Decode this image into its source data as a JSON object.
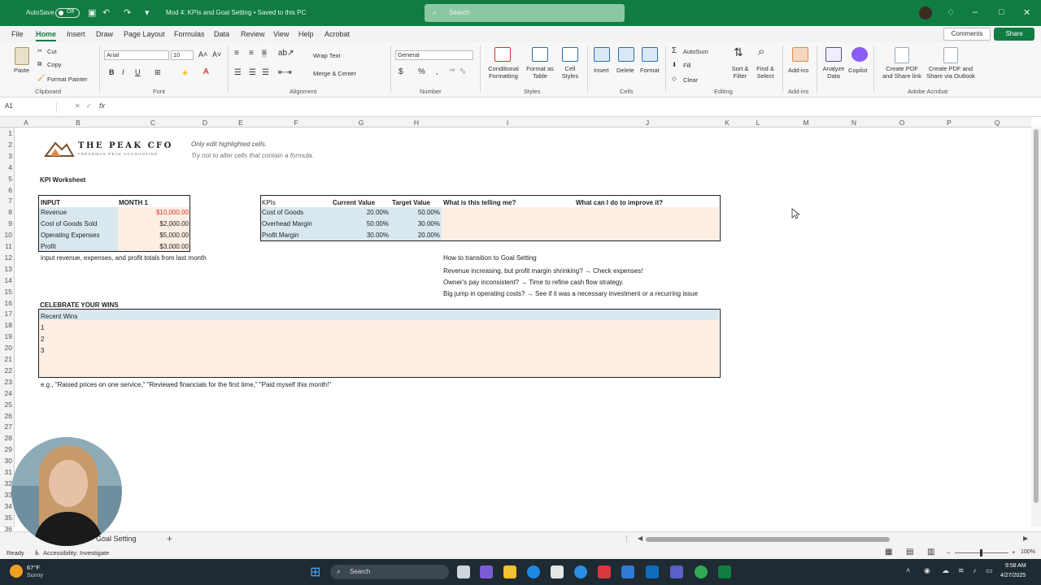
{
  "titlebar": {
    "autosave_label": "AutoSave",
    "autosave_state": "Off",
    "doc_title": "Mod 4: KPIs and Goal Setting • Saved to this PC",
    "search_placeholder": "Search"
  },
  "menu": [
    "File",
    "Home",
    "Insert",
    "Draw",
    "Page Layout",
    "Formulas",
    "Data",
    "Review",
    "View",
    "Help",
    "Acrobat"
  ],
  "menu_active": "Home",
  "comments_label": "Comments",
  "share_label": "Share",
  "ribbon": {
    "paste": "Paste",
    "cut": "Cut",
    "copy": "Copy",
    "format_painter": "Format Painter",
    "clipboard": "Clipboard",
    "font_name": "Arial",
    "font_size": "10",
    "font_group": "Font",
    "wrap_text": "Wrap Text",
    "merge_center": "Merge & Center",
    "alignment": "Alignment",
    "number_format": "General",
    "number": "Number",
    "conditional_formatting": "Conditional Formatting",
    "format_as_table": "Format as Table",
    "cell_styles": "Cell Styles",
    "styles": "Styles",
    "insert": "Insert",
    "delete": "Delete",
    "format": "Format",
    "cells": "Cells",
    "autosum": "AutoSum",
    "fill": "Fill",
    "clear": "Clear",
    "sort_filter": "Sort & Filter",
    "find_select": "Find & Select",
    "editing": "Editing",
    "addins": "Add-ins",
    "addins_group": "Add-ins",
    "analyze_data": "Analyze Data",
    "copilot": "Copilot",
    "create_pdf_link": "Create PDF and Share link",
    "create_pdf_outlook": "Create PDF and Share via Outlook",
    "adobe_acrobat": "Adobe Acrobat"
  },
  "formula_bar": {
    "name_box": "A1",
    "fx": "fx"
  },
  "columns": [
    "A",
    "B",
    "C",
    "D",
    "E",
    "F",
    "G",
    "H",
    "I",
    "J",
    "K",
    "L",
    "M",
    "N",
    "O",
    "P",
    "Q"
  ],
  "rows": [
    "1",
    "2",
    "3",
    "4",
    "5",
    "6",
    "7",
    "8",
    "9",
    "10",
    "11",
    "12",
    "13",
    "14",
    "15",
    "16",
    "17",
    "18",
    "19",
    "20",
    "21",
    "22",
    "23",
    "24",
    "25",
    "26",
    "27",
    "28",
    "29",
    "30",
    "31",
    "32",
    "33",
    "34",
    "35",
    "36"
  ],
  "sheet": {
    "logo_text": "THE PEAK CFO",
    "logo_sub": "FREEDMAN PEAK ACCOUNTING",
    "note1": "Only edit highlighted cells.",
    "note2": "Try not to alter cells that contain a formula.",
    "worksheet_title": "KPI Worksheet",
    "input_header": "INPUT",
    "month_header": "MONTH 1",
    "inputs": [
      {
        "label": "Revenue",
        "value": "$10,000.00"
      },
      {
        "label": "Cost of Goods Sold",
        "value": "$2,000.00"
      },
      {
        "label": "Operating Expenses",
        "value": "$5,000.00"
      },
      {
        "label": "Profit",
        "value": "$3,000.00"
      }
    ],
    "input_note": "input revenue, expenses, and profit totals from last month",
    "kpi_headers": [
      "KPIs",
      "Current Value",
      "Target Value",
      "What is this telling me?",
      "What can I do to improve it?"
    ],
    "kpis": [
      {
        "name": "Cost of Goods",
        "current": "20.00%",
        "target": "50.00%"
      },
      {
        "name": "Overhead Margin",
        "current": "50.00%",
        "target": "30.00%"
      },
      {
        "name": "Profit Margin",
        "current": "30.00%",
        "target": "20.00%"
      }
    ],
    "transition_title": "How to transition to Goal Setting",
    "transitions": [
      "Revenue increasing, but profit margin shrinking? → Check expenses!",
      "Owner's pay inconsistent? → Time to refine cash flow strategy.",
      "Big jump in operating costs? → See if it was a necessary investment or a recurring issue"
    ],
    "celebrate_title": "CELEBRATE YOUR WINS",
    "recent_wins_header": "Recent Wins",
    "wins": [
      "1",
      "2",
      "3"
    ],
    "wins_example": "e.g., \"Raised prices on one service,\" \"Reviewed financials for the first time,\" \"Paid myself this month!\""
  },
  "sheet_tab": "Goal Setting",
  "status": {
    "ready": "Ready",
    "accessibility": "Accessibility: Investigate",
    "zoom": "100%"
  },
  "taskbar": {
    "weather_temp": "67°F",
    "weather_desc": "Sunny",
    "search": "Search",
    "time": "9:58 AM",
    "date": "4/27/2025"
  },
  "colors": {
    "excel_green": "#107c41",
    "input_blue": "#d9e8ef",
    "input_peach": "#fdeee4",
    "revenue_red": "#d9341f"
  }
}
